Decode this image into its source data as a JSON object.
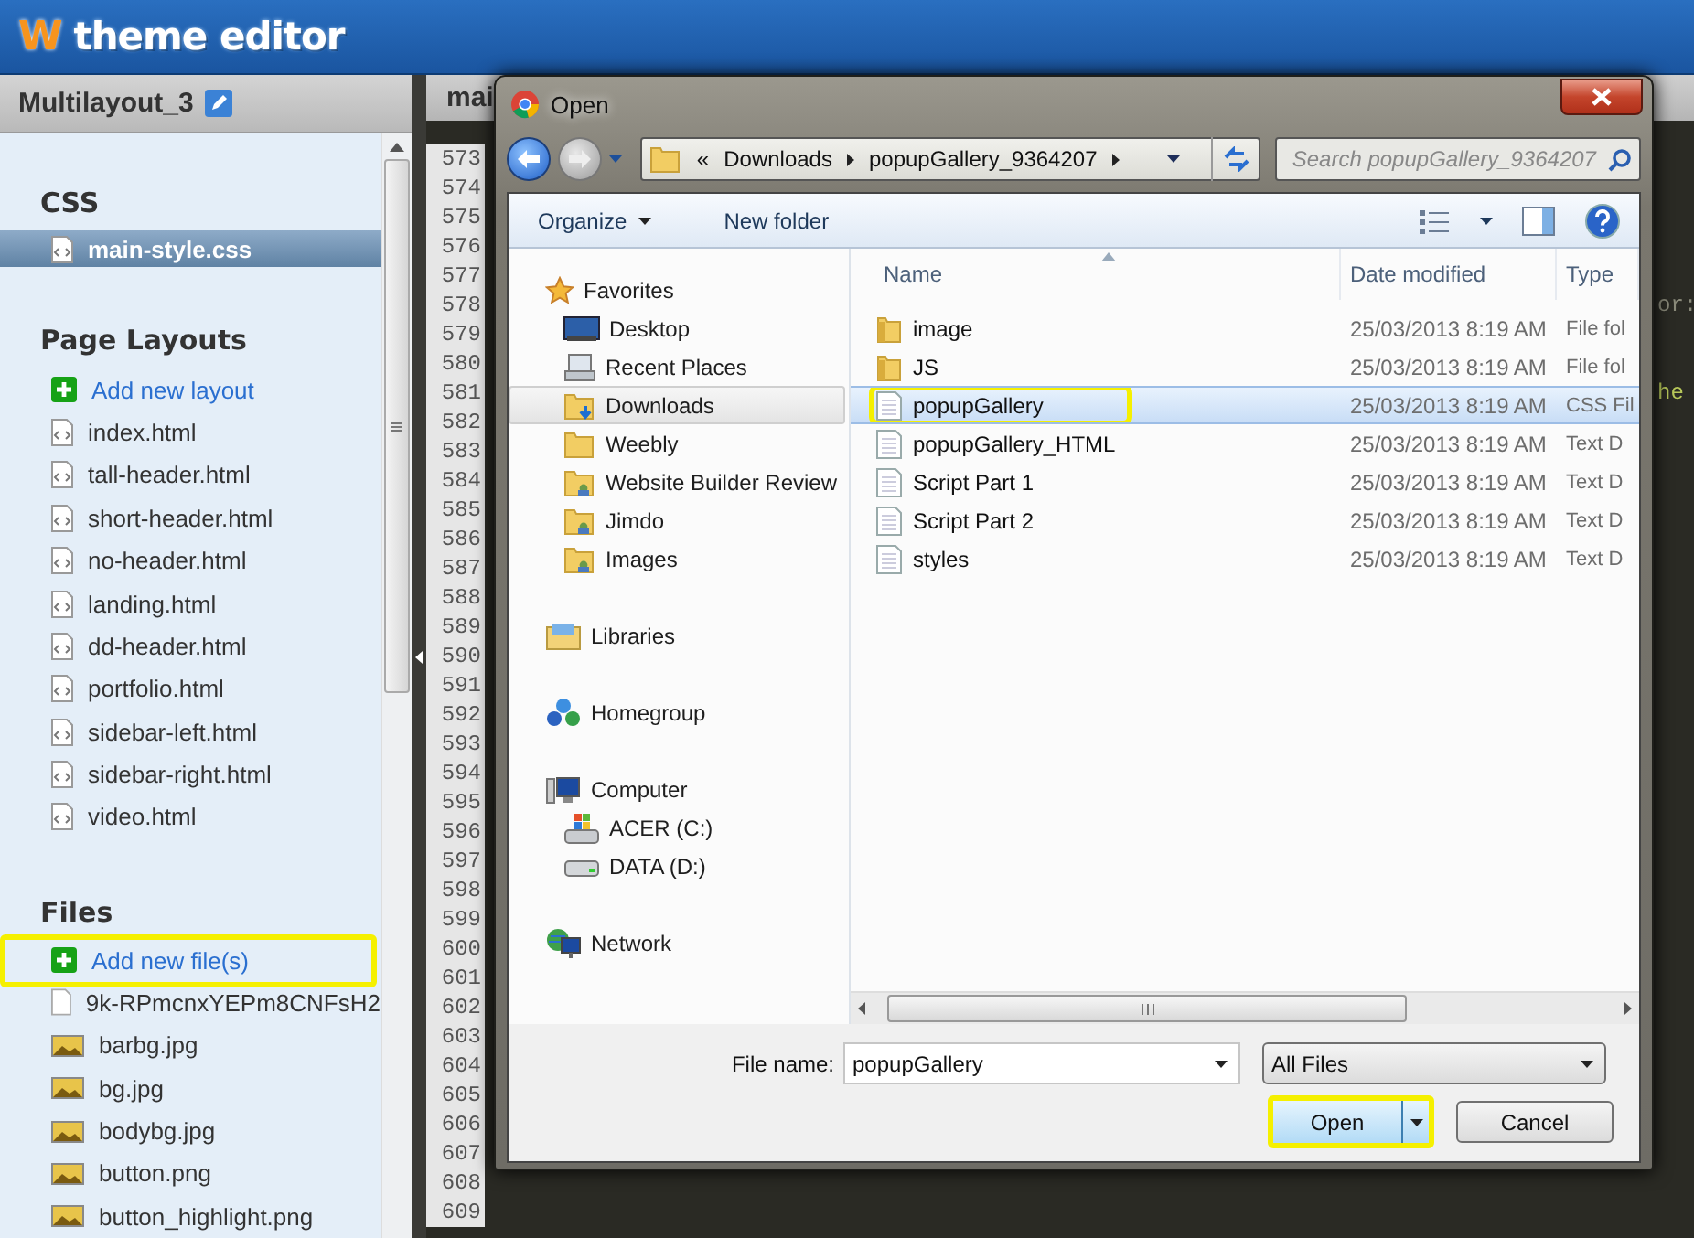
{
  "header": {
    "logo_mark": "W",
    "app_title": "theme editor"
  },
  "sidebar": {
    "project_title": "Multilayout_3",
    "sections": [
      {
        "title": "CSS",
        "items": [
          {
            "label": "main-style.css",
            "kind": "code",
            "selected": true,
            "highlighted": false
          }
        ]
      },
      {
        "title": "Page Layouts",
        "items": [
          {
            "label": "Add new layout",
            "kind": "add",
            "selected": false,
            "highlighted": false
          },
          {
            "label": "index.html",
            "kind": "code",
            "selected": false,
            "highlighted": false
          },
          {
            "label": "tall-header.html",
            "kind": "code",
            "selected": false,
            "highlighted": false
          },
          {
            "label": "short-header.html",
            "kind": "code",
            "selected": false,
            "highlighted": false
          },
          {
            "label": "no-header.html",
            "kind": "code",
            "selected": false,
            "highlighted": false
          },
          {
            "label": "landing.html",
            "kind": "code",
            "selected": false,
            "highlighted": false
          },
          {
            "label": "dd-header.html",
            "kind": "code",
            "selected": false,
            "highlighted": false
          },
          {
            "label": "portfolio.html",
            "kind": "code",
            "selected": false,
            "highlighted": false
          },
          {
            "label": "sidebar-left.html",
            "kind": "code",
            "selected": false,
            "highlighted": false
          },
          {
            "label": "sidebar-right.html",
            "kind": "code",
            "selected": false,
            "highlighted": false
          },
          {
            "label": "video.html",
            "kind": "code",
            "selected": false,
            "highlighted": false
          }
        ]
      },
      {
        "title": "Files",
        "items": [
          {
            "label": "Add new file(s)",
            "kind": "add",
            "selected": false,
            "highlighted": true
          },
          {
            "label": "9k-RPmcnxYEPm8CNFsH2",
            "kind": "blank",
            "selected": false,
            "highlighted": false
          },
          {
            "label": "barbg.jpg",
            "kind": "image",
            "selected": false,
            "highlighted": false
          },
          {
            "label": "bg.jpg",
            "kind": "image",
            "selected": false,
            "highlighted": false
          },
          {
            "label": "bodybg.jpg",
            "kind": "image",
            "selected": false,
            "highlighted": false
          },
          {
            "label": "button.png",
            "kind": "image",
            "selected": false,
            "highlighted": false
          },
          {
            "label": "button_highlight.png",
            "kind": "image",
            "selected": false,
            "highlighted": false
          }
        ]
      }
    ]
  },
  "editor": {
    "tab_label": "mai",
    "lines": [
      {
        "number": "573"
      },
      {
        "number": "574"
      },
      {
        "number": "575"
      },
      {
        "number": "576"
      },
      {
        "number": "577"
      },
      {
        "number": "578",
        "code": "or:"
      },
      {
        "number": "579"
      },
      {
        "number": "580"
      },
      {
        "number": "581",
        "code": "he"
      },
      {
        "number": "582"
      },
      {
        "number": "583"
      },
      {
        "number": "584"
      },
      {
        "number": "585"
      },
      {
        "number": "586"
      },
      {
        "number": "587"
      },
      {
        "number": "588"
      },
      {
        "number": "589"
      },
      {
        "number": "590"
      },
      {
        "number": "591"
      },
      {
        "number": "592"
      },
      {
        "number": "593"
      },
      {
        "number": "594"
      },
      {
        "number": "595"
      },
      {
        "number": "596"
      },
      {
        "number": "597"
      },
      {
        "number": "598"
      },
      {
        "number": "599"
      },
      {
        "number": "600"
      },
      {
        "number": "601"
      },
      {
        "number": "602"
      },
      {
        "number": "603"
      },
      {
        "number": "604"
      },
      {
        "number": "605"
      },
      {
        "number": "606"
      },
      {
        "number": "607"
      },
      {
        "number": "608"
      },
      {
        "number": "609"
      }
    ]
  },
  "dialog": {
    "title": "Open",
    "address": {
      "overflow": "«",
      "crumbs": [
        "Downloads",
        "popupGallery_9364207"
      ]
    },
    "search": {
      "placeholder": "Search popupGallery_9364207"
    },
    "toolbar": [
      {
        "label": "Organize",
        "dropdown": true
      },
      {
        "label": "New folder",
        "dropdown": false
      }
    ],
    "nav": [
      {
        "label": "Favorites",
        "kind": "star",
        "selected": false,
        "children": [
          {
            "label": "Desktop",
            "kind": "desktop",
            "selected": false
          },
          {
            "label": "Recent Places",
            "kind": "recent",
            "selected": false
          },
          {
            "label": "Downloads",
            "kind": "downloads",
            "selected": true
          },
          {
            "label": "Weebly",
            "kind": "folder",
            "selected": false
          },
          {
            "label": "Website Builder Review",
            "kind": "shared",
            "selected": false
          },
          {
            "label": "Jimdo",
            "kind": "shared",
            "selected": false
          },
          {
            "label": "Images",
            "kind": "shared",
            "selected": false
          }
        ]
      },
      {
        "label": "Libraries",
        "kind": "library",
        "selected": false
      },
      {
        "label": "Homegroup",
        "kind": "homegroup",
        "selected": false
      },
      {
        "label": "Computer",
        "kind": "computer",
        "selected": false,
        "children": [
          {
            "label": "ACER (C:)",
            "kind": "system-drive",
            "selected": false
          },
          {
            "label": "DATA (D:)",
            "kind": "drive",
            "selected": false
          }
        ]
      },
      {
        "label": "Network",
        "kind": "network",
        "selected": false
      }
    ],
    "columns": [
      "Name",
      "Date modified",
      "Type"
    ],
    "files": [
      {
        "name": "image",
        "kind": "folder",
        "date": "25/03/2013 8:19 AM",
        "type": "File fol",
        "selected": false,
        "highlighted": false
      },
      {
        "name": "JS",
        "kind": "folder",
        "date": "25/03/2013 8:19 AM",
        "type": "File fol",
        "selected": false,
        "highlighted": false
      },
      {
        "name": "popupGallery",
        "kind": "document",
        "date": "25/03/2013 8:19 AM",
        "type": "CSS Fil",
        "selected": true,
        "highlighted": true
      },
      {
        "name": "popupGallery_HTML",
        "kind": "document",
        "date": "25/03/2013 8:19 AM",
        "type": "Text D",
        "selected": false,
        "highlighted": false
      },
      {
        "name": "Script Part 1",
        "kind": "document",
        "date": "25/03/2013 8:19 AM",
        "type": "Text D",
        "selected": false,
        "highlighted": false
      },
      {
        "name": "Script Part 2",
        "kind": "document",
        "date": "25/03/2013 8:19 AM",
        "type": "Text D",
        "selected": false,
        "highlighted": false
      },
      {
        "name": "styles",
        "kind": "document",
        "date": "25/03/2013 8:19 AM",
        "type": "Text D",
        "selected": false,
        "highlighted": false
      }
    ],
    "file_name": {
      "label": "File name:",
      "value": "popupGallery"
    },
    "filter": {
      "value": "All Files"
    },
    "buttons": [
      {
        "label": "Open",
        "kind": "split",
        "highlighted": true
      },
      {
        "label": "Cancel",
        "kind": "plain",
        "highlighted": false
      }
    ]
  }
}
